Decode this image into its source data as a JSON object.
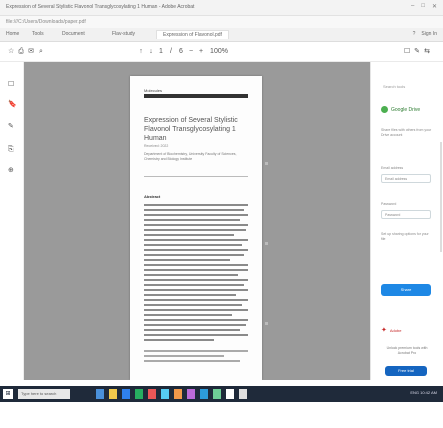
{
  "window": {
    "title": "Expression of Several Stylistic Flavonol Transglycosylating 1 Human - Adobe Acrobat",
    "controls": [
      "–",
      "□",
      "✕"
    ]
  },
  "browser": {
    "url": "file:///C:/Users/Downloads/paper.pdf"
  },
  "tabs": [
    {
      "label": "Home"
    },
    {
      "label": "Tools"
    },
    {
      "label": "Document"
    },
    {
      "label": "Flav-study"
    },
    {
      "label": "Expression of Flavonol.pdf",
      "active": true
    }
  ],
  "tab_actions": [
    "?",
    "Sign In"
  ],
  "toolbar": {
    "left_icons": [
      "☆",
      "⎙",
      "✉",
      "⌕"
    ],
    "center_icons": [
      "↑",
      "↓",
      "1",
      "/",
      "6",
      "−",
      "+",
      "100%"
    ],
    "right_icons": [
      "☐",
      "✎",
      "⇆",
      "⋯"
    ]
  },
  "left_rail_icons": [
    "☐",
    "🔖",
    "✎",
    "⎘",
    "⊕"
  ],
  "document": {
    "journal": "Molecules",
    "title": "Expression of Several Stylistic Flavonol Transglycosylating 1 Human",
    "date": "Received: 2022",
    "affiliation": "Department of Biochemistry, University Faculty of Sciences, Chemistry and Biology Institute",
    "abstract_label": "Abstract"
  },
  "side_panel": {
    "hint": "Search tools",
    "logo_label": "Google Drive",
    "note1": "Share files with others from your Drive account",
    "field1_label": "Email address",
    "field1_value": "Email address",
    "field2_label": "Password",
    "field2_value": "Password",
    "note2": "Set up sharing options for your file",
    "primary_button": "Share",
    "brand": "Adobe",
    "promo": "Unlock premium tools with Acrobat Pro",
    "promo_button": "Free trial"
  },
  "taskbar": {
    "start": "⊞",
    "search_placeholder": "Type here to search",
    "tray_text": "ENG 10:42 AM",
    "accent": "#1f2a3a"
  }
}
